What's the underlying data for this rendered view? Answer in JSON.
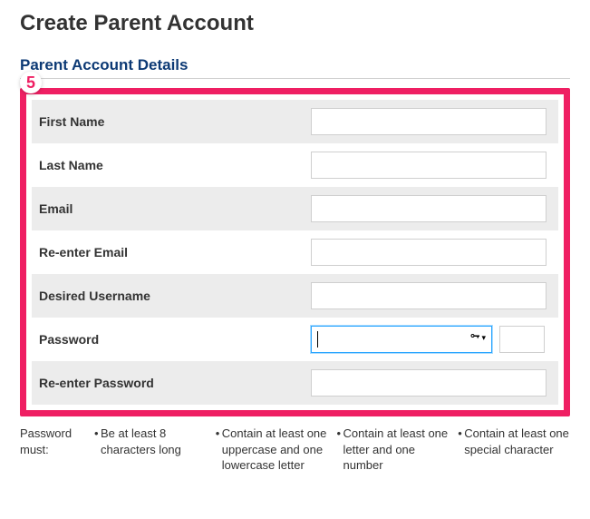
{
  "page": {
    "title": "Create Parent Account",
    "section_title": "Parent Account Details",
    "step_number": "5"
  },
  "form": {
    "first_name": {
      "label": "First Name",
      "value": ""
    },
    "last_name": {
      "label": "Last Name",
      "value": ""
    },
    "email": {
      "label": "Email",
      "value": ""
    },
    "reenter_email": {
      "label": "Re-enter Email",
      "value": ""
    },
    "username": {
      "label": "Desired Username",
      "value": ""
    },
    "password": {
      "label": "Password",
      "value": ""
    },
    "reenter_password": {
      "label": "Re-enter Password",
      "value": ""
    }
  },
  "rules": {
    "lead": "Password must:",
    "r1": "Be at least 8 characters long",
    "r2": "Contain at least one uppercase and one lowercase letter",
    "r3": "Contain at least one letter and one number",
    "r4": "Contain at least one special character"
  }
}
